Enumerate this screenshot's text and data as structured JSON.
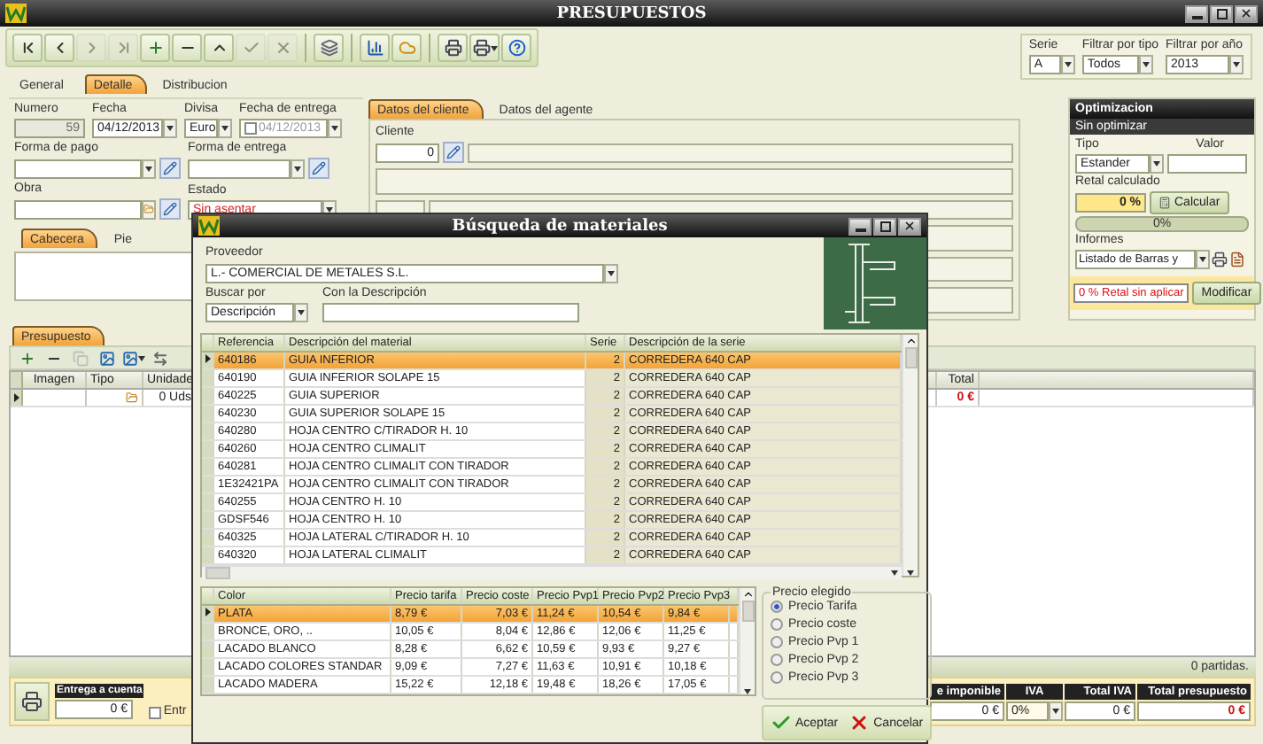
{
  "window": {
    "title": "PRESUPUESTOS"
  },
  "toolbar": [
    [
      {
        "kind": "first",
        "disabled": false
      },
      {
        "kind": "prev",
        "disabled": false
      },
      {
        "kind": "next",
        "disabled": true
      },
      {
        "kind": "last",
        "disabled": true
      },
      {
        "kind": "add",
        "disabled": false
      },
      {
        "kind": "remove",
        "disabled": false
      },
      {
        "kind": "up",
        "disabled": false
      },
      {
        "kind": "confirm",
        "disabled": true
      },
      {
        "kind": "cancel",
        "disabled": true
      }
    ],
    [
      {
        "kind": "tools",
        "disabled": false
      }
    ],
    [
      {
        "kind": "chart",
        "disabled": false
      },
      {
        "kind": "cloud",
        "disabled": false
      }
    ],
    [
      {
        "kind": "print",
        "disabled": false
      },
      {
        "kind": "print_menu",
        "disabled": false
      },
      {
        "kind": "help",
        "disabled": false
      }
    ]
  ],
  "filters": [
    {
      "label": "Serie",
      "value": "A"
    },
    {
      "label": "Filtrar por tipo",
      "value": "Todos"
    },
    {
      "label": "Filtrar por año",
      "value": "2013"
    }
  ],
  "tabs": [
    {
      "label": "General",
      "selected": false
    },
    {
      "label": "Detalle",
      "selected": true
    },
    {
      "label": "Distribucion",
      "selected": false
    }
  ],
  "form": {
    "number_label": "Numero",
    "number": "59",
    "date_label": "Fecha",
    "date": "04/12/2013",
    "currency_label": "Divisa",
    "currency": "Euro",
    "delivery_date_label": "Fecha de entrega",
    "delivery_date": "04/12/2013",
    "delivery_date_enabled": false,
    "payment_label": "Forma de pago",
    "delivery_label": "Forma de entrega",
    "work_label": "Obra",
    "status_label": "Estado",
    "status": "Sin asentar"
  },
  "notes_tabs": [
    {
      "label": "Cabecera",
      "selected": true
    },
    {
      "label": "Pie",
      "selected": false
    }
  ],
  "client_tabs": [
    {
      "label": "Datos del cliente",
      "selected": true
    },
    {
      "label": "Datos del agente",
      "selected": false
    }
  ],
  "client": {
    "label": "Cliente",
    "value": "0"
  },
  "optimization": {
    "title": "Optimizacion",
    "status": "Sin optimizar",
    "type_label": "Tipo",
    "type": "Estander",
    "value_label": "Valor",
    "computed_label": "Retal calculado",
    "computed": "0 %",
    "calc_button": "Calcular",
    "progress": "0%",
    "level": 0,
    "reports_label": "Informes",
    "report": "Listado de Barras y",
    "warning": "0 % Retal sin aplicar",
    "modify_button": "Modificar"
  },
  "budget": {
    "tab": "Presupuesto",
    "toolbar": [
      {
        "kind": "add",
        "disabled": false
      },
      {
        "kind": "remove",
        "disabled": false
      },
      {
        "kind": "copy",
        "disabled": true
      },
      {
        "kind": "image",
        "disabled": false
      },
      {
        "kind": "image_menu",
        "disabled": false
      },
      {
        "kind": "swap",
        "disabled": false
      }
    ],
    "columns": [
      "Imagen",
      "Tipo",
      "Unidade",
      "Total"
    ],
    "row": {
      "units": "0 Uds",
      "total": "0 €"
    },
    "count": "0 partidas."
  },
  "deposit": {
    "label": "Entrega a cuenta",
    "value": "0 €",
    "option_label": "Entr",
    "checked": false
  },
  "summary": [
    {
      "kind": "plain",
      "label": "e imponible",
      "value": "0 €"
    },
    {
      "kind": "select",
      "label": "IVA",
      "value": "0%"
    },
    {
      "kind": "plain",
      "label": "Total IVA",
      "value": "0 €"
    },
    {
      "kind": "total",
      "label": "Total presupuesto",
      "value": "0 €"
    }
  ],
  "dialog": {
    "title": "Búsqueda de materiales",
    "supplier_label": "Proveedor",
    "supplier": "L.- COMERCIAL DE METALES S.L.",
    "search_by_label": "Buscar por",
    "search_by": "Descripción",
    "description_label": "Con la Descripción",
    "materials": {
      "columns": [
        "Referencia",
        "Descripción del material",
        "Serie",
        "Descripción de la serie"
      ],
      "rows": [
        {
          "ref": "640186",
          "description": "GUIA INFERIOR",
          "series": "2",
          "series_description": "CORREDERA 640 CAP",
          "selected": true
        },
        {
          "ref": "640190",
          "description": "GUIA INFERIOR SOLAPE 15",
          "series": "2",
          "series_description": "CORREDERA 640 CAP",
          "selected": false
        },
        {
          "ref": "640225",
          "description": "GUIA SUPERIOR",
          "series": "2",
          "series_description": "CORREDERA 640 CAP",
          "selected": false
        },
        {
          "ref": "640230",
          "description": "GUIA SUPERIOR SOLAPE 15",
          "series": "2",
          "series_description": "CORREDERA 640 CAP",
          "selected": false
        },
        {
          "ref": "640280",
          "description": "HOJA CENTRO C/TIRADOR H. 10",
          "series": "2",
          "series_description": "CORREDERA 640 CAP",
          "selected": false
        },
        {
          "ref": "640260",
          "description": "HOJA CENTRO CLIMALIT",
          "series": "2",
          "series_description": "CORREDERA 640 CAP",
          "selected": false
        },
        {
          "ref": "640281",
          "description": "HOJA CENTRO CLIMALIT CON TIRADOR",
          "series": "2",
          "series_description": "CORREDERA 640 CAP",
          "selected": false
        },
        {
          "ref": "1E32421PA",
          "description": "HOJA CENTRO CLIMALIT CON TIRADOR",
          "series": "2",
          "series_description": "CORREDERA 640 CAP",
          "selected": false
        },
        {
          "ref": "640255",
          "description": "HOJA CENTRO H. 10",
          "series": "2",
          "series_description": "CORREDERA 640 CAP",
          "selected": false
        },
        {
          "ref": "GDSF546",
          "description": "HOJA CENTRO H. 10",
          "series": "2",
          "series_description": "CORREDERA 640 CAP",
          "selected": false
        },
        {
          "ref": "640325",
          "description": "HOJA LATERAL C/TIRADOR H. 10",
          "series": "2",
          "series_description": "CORREDERA 640 CAP",
          "selected": false
        },
        {
          "ref": "640320",
          "description": "HOJA LATERAL CLIMALIT",
          "series": "2",
          "series_description": "CORREDERA 640 CAP",
          "selected": false
        }
      ]
    },
    "colors": {
      "columns": [
        "Color",
        "Precio tarifa",
        "Precio coste",
        "Precio Pvp1",
        "Precio Pvp2",
        "Precio Pvp3"
      ],
      "rows": [
        {
          "cells": [
            "PLATA",
            "8,79 €",
            "7,03 €",
            "11,24 €",
            "10,54 €",
            "9,84 €"
          ],
          "selected": true
        },
        {
          "cells": [
            "BRONCE, ORO, ..",
            "10,05 €",
            "8,04 €",
            "12,86 €",
            "12,06 €",
            "11,25 €"
          ],
          "selected": false
        },
        {
          "cells": [
            "LACADO BLANCO",
            "8,28 €",
            "6,62 €",
            "10,59 €",
            "9,93 €",
            "9,27 €"
          ],
          "selected": false
        },
        {
          "cells": [
            "LACADO COLORES STANDAR",
            "9,09 €",
            "7,27 €",
            "11,63 €",
            "10,91 €",
            "10,18 €"
          ],
          "selected": false
        },
        {
          "cells": [
            "LACADO  MADERA",
            "15,22 €",
            "12,18 €",
            "19,48 €",
            "18,26 €",
            "17,05 €"
          ],
          "selected": false
        }
      ]
    },
    "price_choice": {
      "title": "Precio elegido",
      "options": [
        {
          "label": "Precio Tarifa",
          "selected": true
        },
        {
          "label": "Precio coste",
          "selected": false
        },
        {
          "label": "Precio Pvp 1",
          "selected": false
        },
        {
          "label": "Precio Pvp 2",
          "selected": false
        },
        {
          "label": "Precio Pvp 3",
          "selected": false
        }
      ]
    },
    "buttons": [
      {
        "kind": "accept",
        "label": "Aceptar"
      },
      {
        "kind": "cancel",
        "label": "Cancelar"
      }
    ]
  }
}
